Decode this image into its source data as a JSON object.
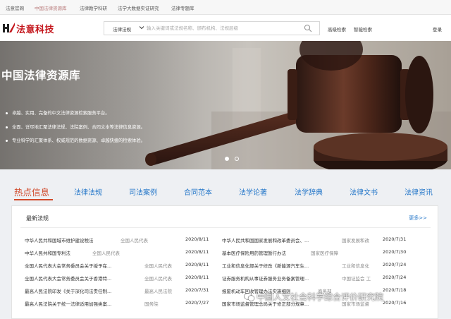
{
  "topnav": {
    "items": [
      "法意官网",
      "中国法律资源库",
      "法律教学科研",
      "法学大数据实证研究",
      "法律专题库"
    ],
    "active_index": 1
  },
  "header": {
    "logo_text": "法意科技",
    "search": {
      "category": "法律法规",
      "placeholder": "输入关键词或法规名称、颁布机构、法规层级"
    },
    "links": [
      "高级检索",
      "智能检索"
    ],
    "login": "登录"
  },
  "hero": {
    "title": "中国法律资源库",
    "bullets": [
      "卓越、实用、完备的中文法律资源检索服务平台。",
      "全面、详尽地汇聚法律法规、法院案例、合同文本等法律信息资源。",
      "专业科学的汇聚体系、权威规范的数据资源、卓越快捷的检索体验。"
    ],
    "slides": 2,
    "active_slide": 0
  },
  "tabs": {
    "items": [
      "热点信息",
      "法律法规",
      "司法案例",
      "合同范本",
      "法学论著",
      "法学辞典",
      "法律文书",
      "法律资讯"
    ],
    "active_index": 0
  },
  "panel": {
    "title": "最新法规",
    "more": "更多>>",
    "left": [
      {
        "title": "中华人民共和国城市维护建设税法",
        "org": "全国人民代表",
        "date": "2020/8/11"
      },
      {
        "title": "中华人民共和国专利法",
        "org": "全国人民代表",
        "date": "2020/8/11"
      },
      {
        "title": "全国人民代表大会常务委员会关于授予在...",
        "org": "全国人民代表",
        "date": "2020/8/11"
      },
      {
        "title": "全国人民代表大会常务委员会关于香港特...",
        "org": "全国人民代表",
        "date": "2020/8/11"
      },
      {
        "title": "最高人民法院印发《关于深化司法责任制...",
        "org": "最高人民法院",
        "date": "2020/7/31"
      },
      {
        "title": "最高人民法院关于统一法律适用加强类案...",
        "org": "国务院",
        "date": "2020/7/27"
      }
    ],
    "right": [
      {
        "title": "中华人民共和国国家发展和改革委员会、...",
        "org": "国家发展和改",
        "date": "2020/7/31"
      },
      {
        "title": "基本医疗保险用药管理暂行办法",
        "org": "国家医疗保障",
        "date": "2020/7/30"
      },
      {
        "title": "工业和信息化部关于修改《新能源汽车生...",
        "org": "工业和信息化",
        "date": "2020/7/24"
      },
      {
        "title": "证券服务机构从事证券服务业务备案管理...",
        "org": "中国证监会 工",
        "date": "2020/7/24"
      },
      {
        "title": "报废机动车回收管理办法实施细则",
        "org": "商务部",
        "date": "2020/7/18"
      },
      {
        "title": "国家市场监督管理总局关于修正部分规章...",
        "org": "国家市场监督",
        "date": "2020/7/16"
      }
    ]
  },
  "watermark": "中国人文社会科学综合评价研究院",
  "colors": {
    "brand_red": "#c4161c",
    "tab_blue": "#2577c9",
    "tab_active": "#d1492a"
  }
}
